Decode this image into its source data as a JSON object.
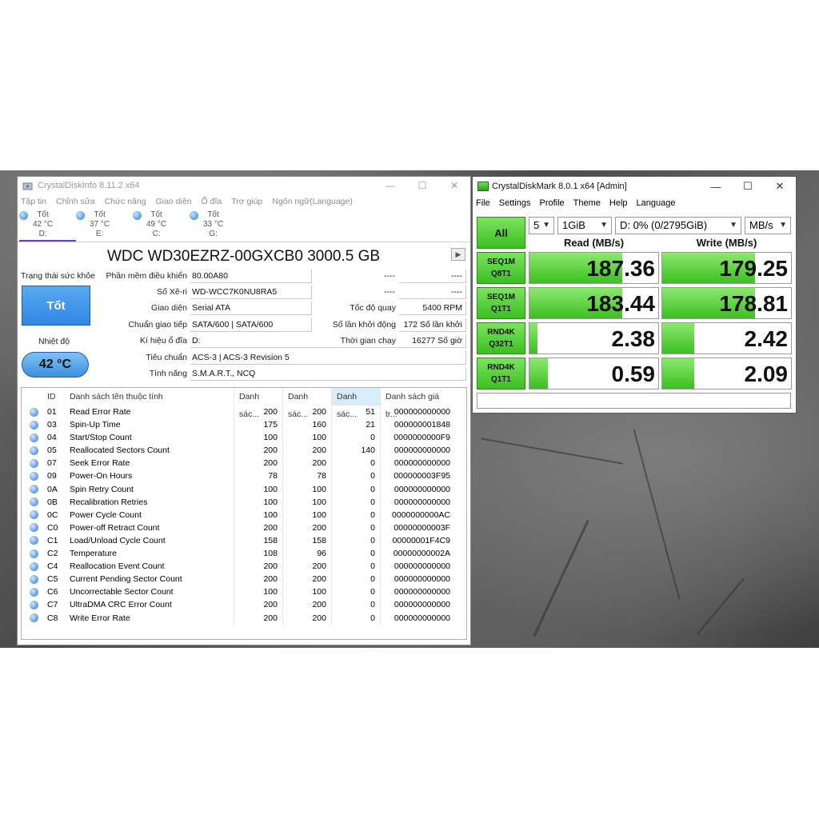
{
  "cdi": {
    "title": "CrystalDiskInfo 8.11.2 x64",
    "menu": [
      "Tập tin",
      "Chỉnh sửa",
      "Chức năng",
      "Giao diện",
      "Ổ đĩa",
      "Trợ giúp",
      "Ngôn ngữ(Language)"
    ],
    "drives": [
      {
        "status": "Tốt",
        "temp": "42 °C",
        "letter": "D:"
      },
      {
        "status": "Tốt",
        "temp": "37 °C",
        "letter": "E:"
      },
      {
        "status": "Tốt",
        "temp": "49 °C",
        "letter": "C:"
      },
      {
        "status": "Tốt",
        "temp": "33 °C",
        "letter": "G:"
      }
    ],
    "model": "WDC WD30EZRZ-00GXCB0 3000.5 GB",
    "health_label": "Trạng thái sức khỏe",
    "health_value": "Tốt",
    "temp_label": "Nhiệt độ",
    "temp_value": "42 °C",
    "fields": {
      "firmware_label": "Phần mềm điều khiển",
      "firmware": "80.00A80",
      "serial_label": "Số Xê-ri",
      "serial": "WD-WCC7K0NU8RA5",
      "interface_label": "Giao diện",
      "interface": "Serial ATA",
      "transfer_label": "Chuẩn giao tiếp",
      "transfer": "SATA/600 | SATA/600",
      "drive_letter_label": "Kí hiệu ổ đĩa",
      "drive_letter": "D:",
      "standard_label": "Tiêu chuẩn",
      "standard": "ACS-3 | ACS-3 Revision 5",
      "features_label": "Tính năng",
      "features": "S.M.A.R.T., NCQ",
      "dash1a": "----",
      "dash1b": "----",
      "dash2a": "----",
      "dash2b": "----",
      "rotation_label": "Tốc độ quay",
      "rotation": "5400 RPM",
      "power_count_label": "Số lần khởi động",
      "power_count": "172 Số lần khởi",
      "power_hours_label": "Thời gian chạy",
      "power_hours": "16277 Số giờ"
    },
    "table_headers": [
      "ID",
      "Danh sách tên thuộc tính",
      "Danh sác...",
      "Danh sác...",
      "Danh sác...",
      "Danh sách giá tr..."
    ],
    "rows": [
      {
        "id": "01",
        "name": "Read Error Rate",
        "cur": "200",
        "worst": "200",
        "thr": "51",
        "raw": "000000000000"
      },
      {
        "id": "03",
        "name": "Spin-Up Time",
        "cur": "175",
        "worst": "160",
        "thr": "21",
        "raw": "000000001848"
      },
      {
        "id": "04",
        "name": "Start/Stop Count",
        "cur": "100",
        "worst": "100",
        "thr": "0",
        "raw": "0000000000F9"
      },
      {
        "id": "05",
        "name": "Reallocated Sectors Count",
        "cur": "200",
        "worst": "200",
        "thr": "140",
        "raw": "000000000000"
      },
      {
        "id": "07",
        "name": "Seek Error Rate",
        "cur": "200",
        "worst": "200",
        "thr": "0",
        "raw": "000000000000"
      },
      {
        "id": "09",
        "name": "Power-On Hours",
        "cur": "78",
        "worst": "78",
        "thr": "0",
        "raw": "000000003F95"
      },
      {
        "id": "0A",
        "name": "Spin Retry Count",
        "cur": "100",
        "worst": "100",
        "thr": "0",
        "raw": "000000000000"
      },
      {
        "id": "0B",
        "name": "Recalibration Retries",
        "cur": "100",
        "worst": "100",
        "thr": "0",
        "raw": "000000000000"
      },
      {
        "id": "0C",
        "name": "Power Cycle Count",
        "cur": "100",
        "worst": "100",
        "thr": "0",
        "raw": "0000000000AC"
      },
      {
        "id": "C0",
        "name": "Power-off Retract Count",
        "cur": "200",
        "worst": "200",
        "thr": "0",
        "raw": "00000000003F"
      },
      {
        "id": "C1",
        "name": "Load/Unload Cycle Count",
        "cur": "158",
        "worst": "158",
        "thr": "0",
        "raw": "00000001F4C9"
      },
      {
        "id": "C2",
        "name": "Temperature",
        "cur": "108",
        "worst": "96",
        "thr": "0",
        "raw": "00000000002A"
      },
      {
        "id": "C4",
        "name": "Reallocation Event Count",
        "cur": "200",
        "worst": "200",
        "thr": "0",
        "raw": "000000000000"
      },
      {
        "id": "C5",
        "name": "Current Pending Sector Count",
        "cur": "200",
        "worst": "200",
        "thr": "0",
        "raw": "000000000000"
      },
      {
        "id": "C6",
        "name": "Uncorrectable Sector Count",
        "cur": "100",
        "worst": "100",
        "thr": "0",
        "raw": "000000000000"
      },
      {
        "id": "C7",
        "name": "UltraDMA CRC Error Count",
        "cur": "200",
        "worst": "200",
        "thr": "0",
        "raw": "000000000000"
      },
      {
        "id": "C8",
        "name": "Write Error Rate",
        "cur": "200",
        "worst": "200",
        "thr": "0",
        "raw": "000000000000"
      }
    ]
  },
  "cdm": {
    "title": "CrystalDiskMark 8.0.1 x64 [Admin]",
    "menu": [
      "File",
      "Settings",
      "Profile",
      "Theme",
      "Help",
      "Language"
    ],
    "all_label": "All",
    "count": "5",
    "size": "1GiB",
    "drive": "D: 0% (0/2795GiB)",
    "unit": "MB/s",
    "read_header": "Read (MB/s)",
    "write_header": "Write (MB/s)",
    "tests": [
      {
        "line1": "SEQ1M",
        "line2": "Q8T1",
        "read": "187.36",
        "write": "179.25",
        "read_fill": 0.72,
        "write_fill": 0.72
      },
      {
        "line1": "SEQ1M",
        "line2": "Q1T1",
        "read": "183.44",
        "write": "178.81",
        "read_fill": 0.72,
        "write_fill": 0.72
      },
      {
        "line1": "RND4K",
        "line2": "Q32T1",
        "read": "2.38",
        "write": "2.42",
        "read_fill": 0.06,
        "write_fill": 0.25
      },
      {
        "line1": "RND4K",
        "line2": "Q1T1",
        "read": "0.59",
        "write": "2.09",
        "read_fill": 0.14,
        "write_fill": 0.25
      }
    ],
    "status_text": ""
  },
  "colors": {
    "accent_green": "#3cbf21",
    "health_blue": "#2f86e4"
  }
}
